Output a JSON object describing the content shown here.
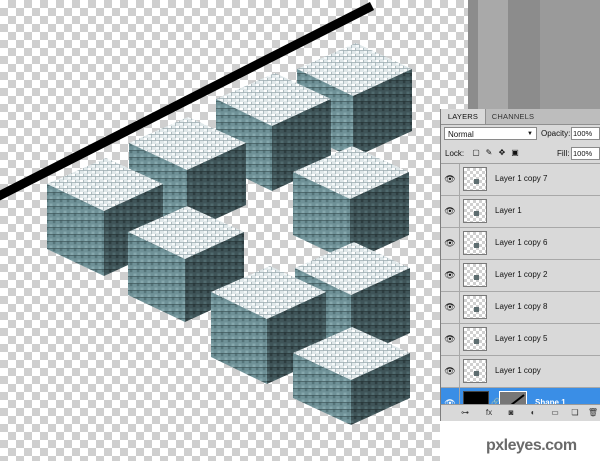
{
  "panel": {
    "tabs": [
      "LAYERS",
      "CHANNELS"
    ],
    "blend_mode": "Normal",
    "opacity_label": "Opacity:",
    "opacity_value": "100%",
    "lock_label": "Lock:",
    "fill_label": "Fill:",
    "fill_value": "100%"
  },
  "layers": [
    {
      "name": "Layer 1 copy 7",
      "visible": true,
      "selected": false
    },
    {
      "name": "Layer 1",
      "visible": true,
      "selected": false
    },
    {
      "name": "Layer 1 copy 6",
      "visible": true,
      "selected": false
    },
    {
      "name": "Layer 1 copy 2",
      "visible": true,
      "selected": false
    },
    {
      "name": "Layer 1 copy 8",
      "visible": true,
      "selected": false
    },
    {
      "name": "Layer 1 copy 5",
      "visible": true,
      "selected": false
    },
    {
      "name": "Layer 1 copy",
      "visible": true,
      "selected": false
    },
    {
      "name": "Shape 1",
      "visible": true,
      "selected": true
    }
  ],
  "watermark": "pxleyes.com",
  "colors": {
    "selection": "#3a8ee6",
    "cube_top": "#d2dcdf",
    "cube_left": "#6a8f96",
    "cube_right": "#3d5155",
    "line": "#000000"
  },
  "icons": {
    "eye": "eye-icon",
    "link": "link-icon",
    "cursor": "hand-cursor-icon"
  }
}
